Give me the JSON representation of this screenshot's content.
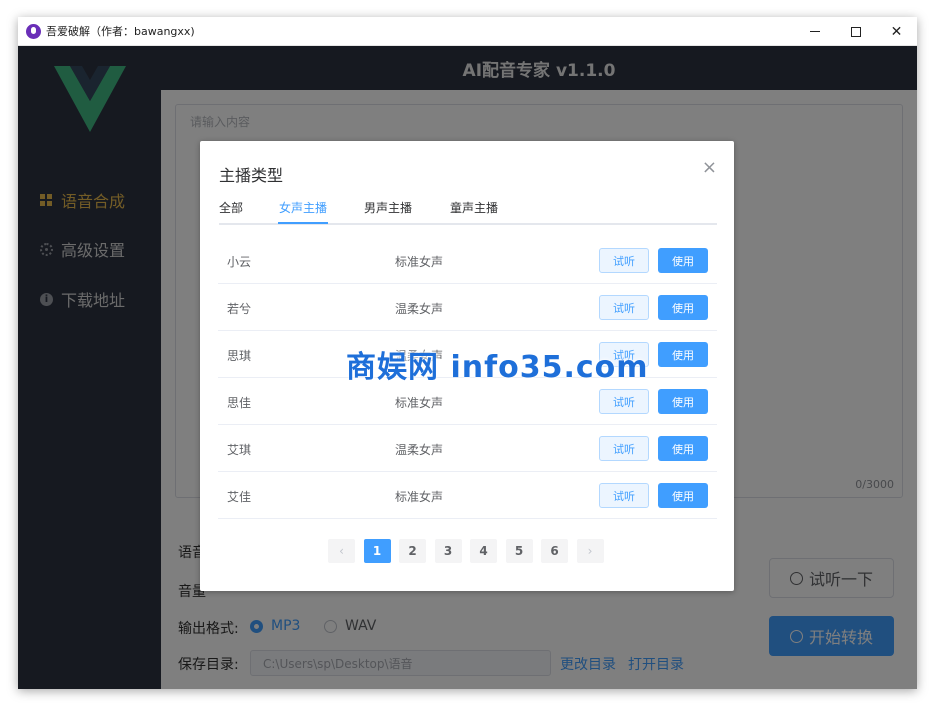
{
  "window": {
    "title": "吾爱破解（作者：bawangxx)"
  },
  "sidebar": {
    "items": [
      {
        "label": "语音合成"
      },
      {
        "label": "高级设置"
      },
      {
        "label": "下载地址"
      }
    ]
  },
  "header": {
    "title": "AI配音专家 v1.1.0"
  },
  "editor": {
    "placeholder": "请输入内容",
    "count": "0/3000"
  },
  "form": {
    "label_voice": "语音",
    "label_volume": "音量",
    "label_format": "输出格式:",
    "format_options": [
      "MP3",
      "WAV"
    ],
    "label_dir": "保存目录:",
    "dir_value": "C:\\Users\\sp\\Desktop\\语音",
    "change_dir": "更改目录",
    "open_dir": "打开目录",
    "preview_button": "试听一下",
    "convert_button": "开始转换"
  },
  "dialog": {
    "title": "主播类型",
    "close": "×",
    "tabs": [
      "全部",
      "女声主播",
      "男声主播",
      "童声主播"
    ],
    "listen_label": "试听",
    "use_label": "使用",
    "rows": [
      {
        "name": "小云",
        "type": "标准女声"
      },
      {
        "name": "若兮",
        "type": "温柔女声"
      },
      {
        "name": "思琪",
        "type": "温柔女声"
      },
      {
        "name": "思佳",
        "type": "标准女声"
      },
      {
        "name": "艾琪",
        "type": "温柔女声"
      },
      {
        "name": "艾佳",
        "type": "标准女声"
      }
    ],
    "pages": [
      "1",
      "2",
      "3",
      "4",
      "5",
      "6"
    ],
    "prev": "‹",
    "next": "›"
  },
  "watermark": "商娱网 info35.com",
  "colors": {
    "accent": "#409eff",
    "sidebar": "#2c3240",
    "active_nav": "#e6b84d"
  }
}
